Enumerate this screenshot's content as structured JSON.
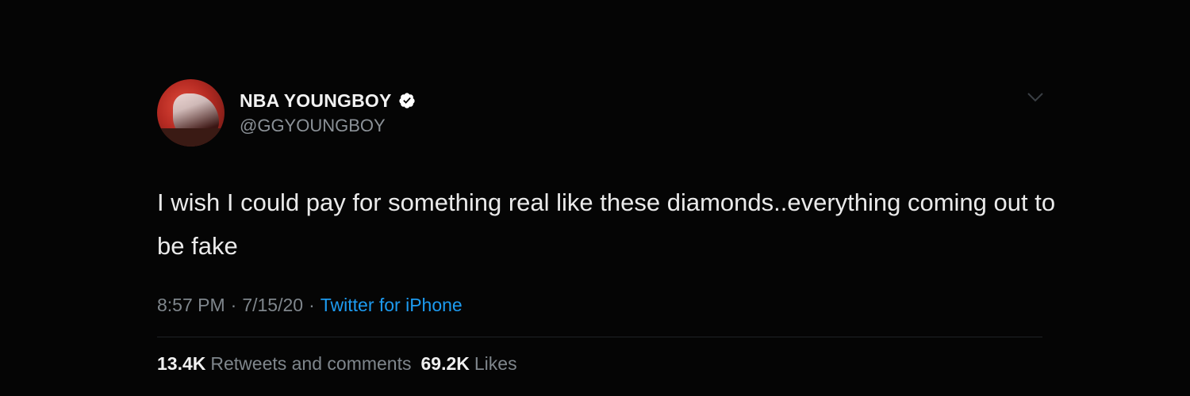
{
  "tweet": {
    "author": {
      "display_name": "NBA YOUNGBOY",
      "handle": "@GGYOUNGBOY",
      "verified": true
    },
    "text": "I wish I could pay for something real like these diamonds..everything coming out to be fake",
    "time": "8:57 PM",
    "date": "7/15/20",
    "separator": "·",
    "source": "Twitter for iPhone",
    "stats": {
      "retweets_count": "13.4K",
      "retweets_label": "Retweets and comments",
      "likes_count": "69.2K",
      "likes_label": "Likes"
    }
  },
  "icons": {
    "verified": "verified-badge-icon",
    "menu": "chevron-down-icon"
  },
  "colors": {
    "background": "#000000",
    "link": "#1d9bf0",
    "secondary_text": "#7f868c",
    "primary_text": "#eaeaea"
  }
}
